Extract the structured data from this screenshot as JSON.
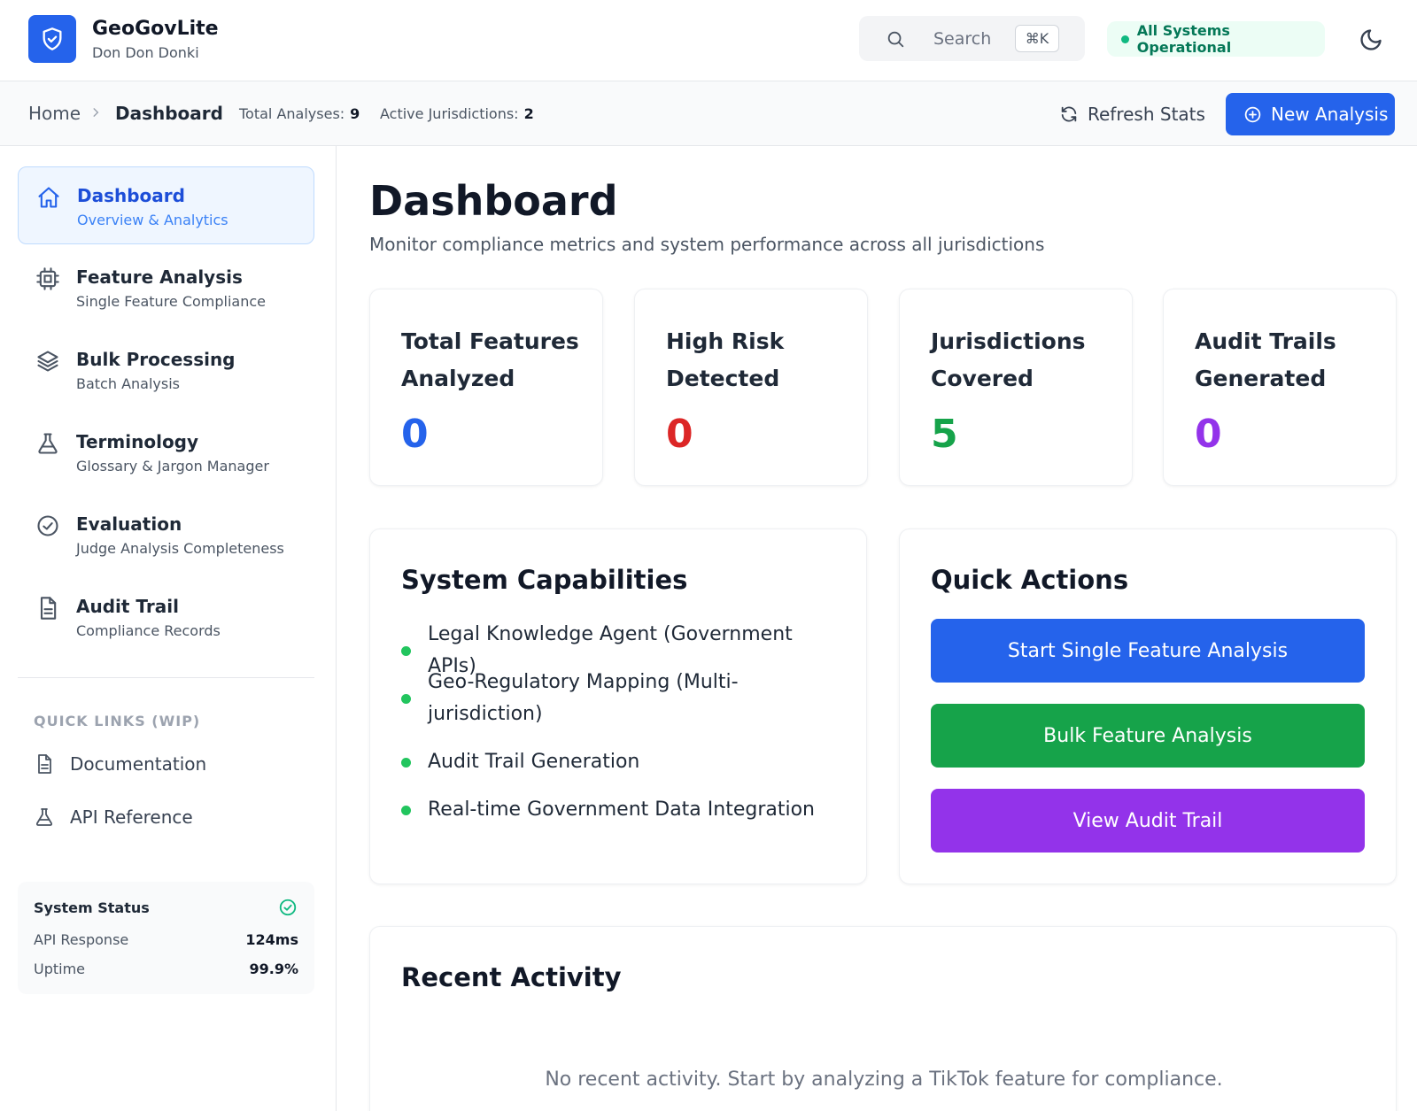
{
  "header": {
    "app_title": "GeoGovLite",
    "app_subtitle": "Don Don Donki",
    "search_placeholder": "Search",
    "search_shortcut": "⌘K",
    "status_text": "All Systems Operational"
  },
  "toolbar": {
    "breadcrumb_home": "Home",
    "breadcrumb_current": "Dashboard",
    "total_analyses_label": "Total Analyses:",
    "total_analyses_value": "9",
    "active_jurisdictions_label": "Active Jurisdictions:",
    "active_jurisdictions_value": "2",
    "refresh_label": "Refresh Stats",
    "new_analysis_label": "New Analysis"
  },
  "sidebar": {
    "items": [
      {
        "label": "Dashboard",
        "sub": "Overview & Analytics",
        "icon": "home-icon"
      },
      {
        "label": "Feature Analysis",
        "sub": "Single Feature Compliance",
        "icon": "cpu-icon"
      },
      {
        "label": "Bulk Processing",
        "sub": "Batch Analysis",
        "icon": "layers-icon"
      },
      {
        "label": "Terminology",
        "sub": "Glossary & Jargon Manager",
        "icon": "flask-icon"
      },
      {
        "label": "Evaluation",
        "sub": "Judge Analysis Completeness",
        "icon": "check-circle-icon"
      },
      {
        "label": "Audit Trail",
        "sub": "Compliance Records",
        "icon": "document-icon"
      }
    ],
    "quick_links_title": "QUICK LINKS (WIP)",
    "quick_links": [
      {
        "label": "Documentation",
        "icon": "document-icon"
      },
      {
        "label": "API Reference",
        "icon": "flask-icon"
      }
    ],
    "system_status": {
      "title": "System Status",
      "api_label": "API Response",
      "api_value": "124ms",
      "uptime_label": "Uptime",
      "uptime_value": "99.9%"
    }
  },
  "main": {
    "title": "Dashboard",
    "subtitle": "Monitor compliance metrics and system performance across all jurisdictions",
    "stats": [
      {
        "label": "Total Features Analyzed",
        "value": "0",
        "color": "#2563eb"
      },
      {
        "label": "High Risk Detected",
        "value": "0",
        "color": "#dc2626"
      },
      {
        "label": "Jurisdictions Covered",
        "value": "5",
        "color": "#16a34a"
      },
      {
        "label": "Audit Trails Generated",
        "value": "0",
        "color": "#9333ea"
      }
    ],
    "capabilities": {
      "title": "System Capabilities",
      "items": [
        "Legal Knowledge Agent (Government APIs)",
        "Geo-Regulatory Mapping (Multi-jurisdiction)",
        "Audit Trail Generation",
        "Real-time Government Data Integration"
      ]
    },
    "quick_actions": {
      "title": "Quick Actions",
      "buttons": [
        {
          "label": "Start Single Feature Analysis",
          "color": "#2563eb"
        },
        {
          "label": "Bulk Feature Analysis",
          "color": "#16a34a"
        },
        {
          "label": "View Audit Trail",
          "color": "#9333ea"
        }
      ]
    },
    "recent_activity": {
      "title": "Recent Activity",
      "empty_text": "No recent activity. Start by analyzing a TikTok feature for compliance."
    }
  },
  "colors": {
    "accent": "#2563eb",
    "success": "#16a34a",
    "danger": "#dc2626",
    "purple": "#9333ea"
  }
}
